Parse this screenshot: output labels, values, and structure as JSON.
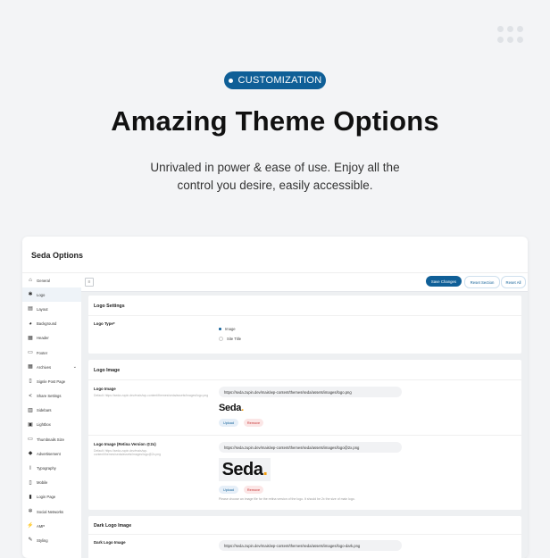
{
  "badge": {
    "label": "CUSTOMIZATION"
  },
  "headline": "Amazing Theme Options",
  "subline": "Unrivaled in power & ease of use. Enjoy all the control you desire, easily accessible.",
  "app": {
    "title": "Seda Options",
    "sidebar": [
      {
        "label": "General",
        "icon": "home-icon",
        "glyph": "⌂"
      },
      {
        "label": "Logo",
        "icon": "bulb-icon",
        "glyph": "✱",
        "active": true
      },
      {
        "label": "Layout",
        "icon": "layout-icon",
        "glyph": "▤"
      },
      {
        "label": "Background",
        "icon": "palette-icon",
        "glyph": "◕"
      },
      {
        "label": "Header",
        "icon": "header-icon",
        "glyph": "▦"
      },
      {
        "label": "Footer",
        "icon": "footer-icon",
        "glyph": "▭"
      },
      {
        "label": "Archives",
        "icon": "archive-icon",
        "glyph": "▦",
        "chevron": "⌄"
      },
      {
        "label": "Signle Post Page",
        "icon": "document-icon",
        "glyph": "▯"
      },
      {
        "label": "Share Settings",
        "icon": "share-icon",
        "glyph": "<"
      },
      {
        "label": "Sidebars",
        "icon": "sidebar-icon",
        "glyph": "▥"
      },
      {
        "label": "Lightbox",
        "icon": "lightbox-icon",
        "glyph": "▣"
      },
      {
        "label": "Thumbnails Size",
        "icon": "thumbnail-icon",
        "glyph": "▭"
      },
      {
        "label": "Advertisement",
        "icon": "megaphone-icon",
        "glyph": "◆"
      },
      {
        "label": "Typography",
        "icon": "italic-icon",
        "glyph": "I"
      },
      {
        "label": "Mobile",
        "icon": "mobile-icon",
        "glyph": "▯"
      },
      {
        "label": "Login Page",
        "icon": "login-icon",
        "glyph": "▮"
      },
      {
        "label": "Social Networks",
        "icon": "network-icon",
        "glyph": "✲"
      },
      {
        "label": "AMP",
        "icon": "amp-icon",
        "glyph": "⚡"
      },
      {
        "label": "Styling",
        "icon": "brush-icon",
        "glyph": "✎"
      }
    ],
    "toolbar": {
      "save": "Save Changes",
      "reset_section": "Reset Section",
      "reset_all": "Reset All"
    },
    "logo_settings": {
      "title": "Logo Settings",
      "logo_type_label": "Logo Type*",
      "options": [
        "Image",
        "Site Title"
      ],
      "selected": "Image"
    },
    "logo_image": {
      "title": "Logo Image",
      "field1": {
        "label": "Logo Image",
        "desc": "Default: https://seda.zupin.dev/mais/wp-content/themes/seda/assets/images/logo.png",
        "url": "https://seda.zupin.dev/mais/wp-content/themes/seda/assets/images/logo.png",
        "preview": "Seda",
        "upload": "Upload",
        "remove": "Remove"
      },
      "field2": {
        "label": "Logo Image (Retina Version @2x)",
        "desc": "Default: https://seda.zupin.dev/mais/wp-content/themes/seda/assets/images/logo@2x.png",
        "url": "https://seda.zupin.dev/mais/wp-content/themes/seda/assets/images/logo@2x.png",
        "preview": "Seda",
        "upload": "Upload",
        "remove": "Remove",
        "hint": "Please choose an image file for the retina version of the logo. It should be 2x the size of main logo."
      }
    },
    "dark_logo": {
      "title": "Dark Logo Image",
      "label": "Dark Logo Image",
      "url": "https://seda.zupin.dev/mais/wp-content/themes/seda/assets/images/logo-dark.png"
    }
  }
}
